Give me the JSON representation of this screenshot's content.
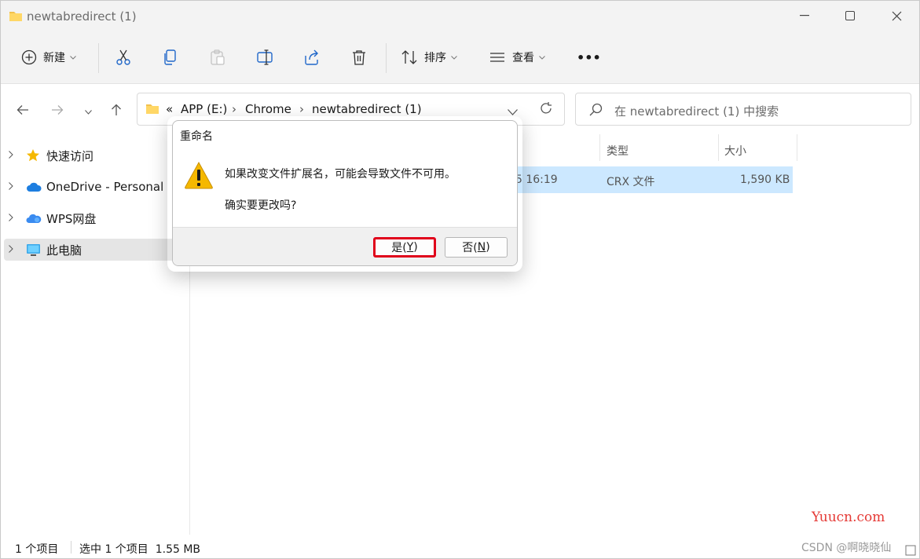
{
  "window": {
    "title": "newtabredirect (1)"
  },
  "toolbar": {
    "new_label": "新建",
    "sort_label": "排序",
    "view_label": "查看",
    "more_label": "•••"
  },
  "address": {
    "overflow": "«",
    "crumbs": [
      "APP (E:)",
      "Chrome",
      "newtabredirect (1)"
    ],
    "sep": "›"
  },
  "search": {
    "placeholder": "在 newtabredirect (1) 中搜索"
  },
  "sidebar": {
    "items": [
      {
        "label": "快速访问"
      },
      {
        "label": "OneDrive - Personal"
      },
      {
        "label": "WPS网盘"
      },
      {
        "label": "此电脑"
      }
    ]
  },
  "columns": {
    "type": "类型",
    "size": "大小"
  },
  "file": {
    "modified_partial": "5 16:19",
    "type": "CRX 文件",
    "size": "1,590 KB"
  },
  "status": {
    "count": "1 个项目",
    "selected": "选中 1 个项目  1.55 MB"
  },
  "dialog": {
    "title": "重命名",
    "message": "如果改变文件扩展名，可能会导致文件不可用。",
    "question": "确实要更改吗?",
    "yes_prefix": "是(",
    "yes_key": "Y",
    "yes_suffix": ")",
    "no_prefix": "否(",
    "no_key": "N",
    "no_suffix": ")"
  },
  "watermark": {
    "site": "Yuucn.com",
    "csdn": "CSDN @啊晓晓仙"
  },
  "colors": {
    "accent_selection": "#cce8ff",
    "highlight_border": "#e0001a",
    "warning": "#f5b800"
  }
}
